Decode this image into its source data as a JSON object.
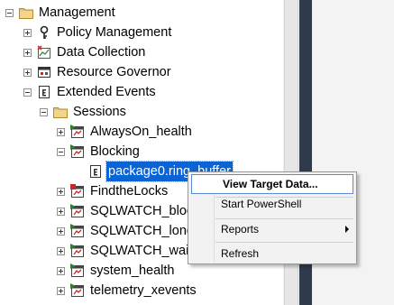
{
  "tree": {
    "management": "Management",
    "policy_management": "Policy Management",
    "data_collection": "Data Collection",
    "resource_governor": "Resource Governor",
    "extended_events": "Extended Events",
    "sessions": "Sessions",
    "session_items": [
      {
        "label": "AlwaysOn_health"
      },
      {
        "label": "Blocking"
      },
      {
        "label": "FindtheLocks"
      },
      {
        "label": "SQLWATCH_bloc"
      },
      {
        "label": "SQLWATCH_long"
      },
      {
        "label": "SQLWATCH_wait"
      },
      {
        "label": "system_health"
      },
      {
        "label": "telemetry_xevents"
      }
    ],
    "target": "package0.ring_buffer"
  },
  "context_menu": {
    "view_target_data": "View Target Data...",
    "start_powershell": "Start PowerShell",
    "reports": "Reports",
    "refresh": "Refresh"
  },
  "icons": {
    "folder": "folder-icon",
    "policy": "policy-icon",
    "data_collection": "data-collection-icon",
    "resource_governor": "resource-governor-icon",
    "extended_events": "extended-events-icon",
    "session": "session-icon",
    "target": "target-icon"
  },
  "colors": {
    "selection": "#0a64d6",
    "menu_highlight_border": "#5b8ad8",
    "folder": "#dcb35c",
    "divider": "#2f3a4d"
  }
}
